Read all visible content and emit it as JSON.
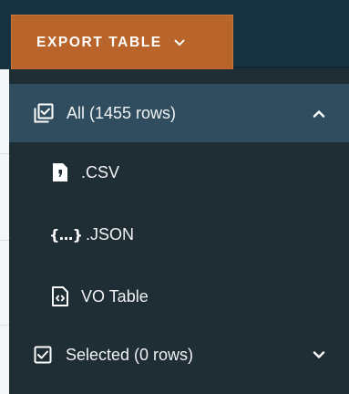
{
  "export_button": {
    "label": "EXPORT TABLE",
    "icon": "chevron-down-icon"
  },
  "menu": {
    "all": {
      "label": "All (1455 rows)",
      "icon": "select-all-icon",
      "trailing_icon": "chevron-up-icon",
      "expanded": true,
      "formats": [
        {
          "label": ".CSV",
          "icon": "csv-file-icon"
        },
        {
          "label": ".JSON",
          "icon": "json-braces-icon",
          "icon_text": "{...}"
        },
        {
          "label": "VO Table",
          "icon": "code-file-icon"
        }
      ]
    },
    "selected": {
      "label": "Selected (0 rows)",
      "icon": "checkbox-checked-icon",
      "trailing_icon": "chevron-down-icon",
      "expanded": false
    }
  },
  "colors": {
    "header_bg": "#17333f",
    "button_bg": "#b9642a",
    "menu_bg": "#1f2d35",
    "menu_active_bg": "#2f4d5e",
    "text": "#f0f2f4"
  }
}
